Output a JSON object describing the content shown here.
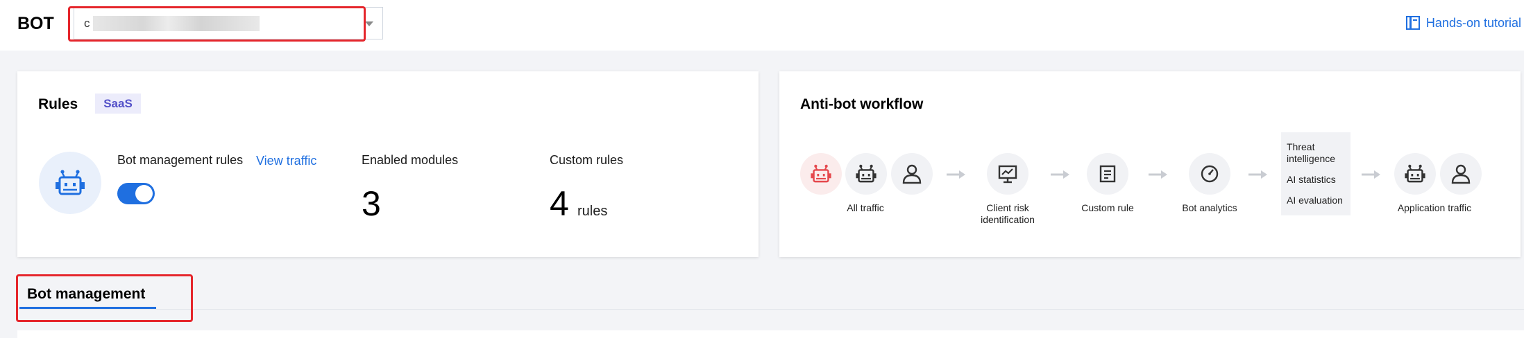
{
  "header": {
    "brand": "BOT",
    "select_value": "c",
    "tutorial_label": "Hands-on tutorial"
  },
  "rules_card": {
    "title": "Rules",
    "badge": "SaaS",
    "bot_rules_label": "Bot management rules",
    "view_traffic": "View traffic",
    "toggle_on": true,
    "enabled_modules_label": "Enabled modules",
    "enabled_modules_value": "3",
    "custom_rules_label": "Custom rules",
    "custom_rules_value": "4",
    "custom_rules_unit": "rules"
  },
  "workflow_card": {
    "title": "Anti-bot workflow",
    "steps": {
      "all_traffic": "All traffic",
      "client_risk_line1": "Client risk",
      "client_risk_line2": "identification",
      "custom_rule": "Custom rule",
      "bot_analytics": "Bot analytics",
      "threat_line1": "Threat",
      "threat_line2": "intelligence",
      "ai_statistics": "AI statistics",
      "ai_evaluation": "AI evaluation",
      "application_traffic": "Application traffic"
    }
  },
  "tabs": {
    "active": "Bot management"
  },
  "colors": {
    "accent": "#1f6fe0",
    "highlight_box": "#e5262c",
    "bot_red": "#e5484d"
  },
  "icons": [
    "robot-icon",
    "user-icon",
    "monitor-chart-icon",
    "document-icon",
    "gauge-icon",
    "book-icon",
    "chevron-down-icon",
    "arrow-right-icon"
  ]
}
